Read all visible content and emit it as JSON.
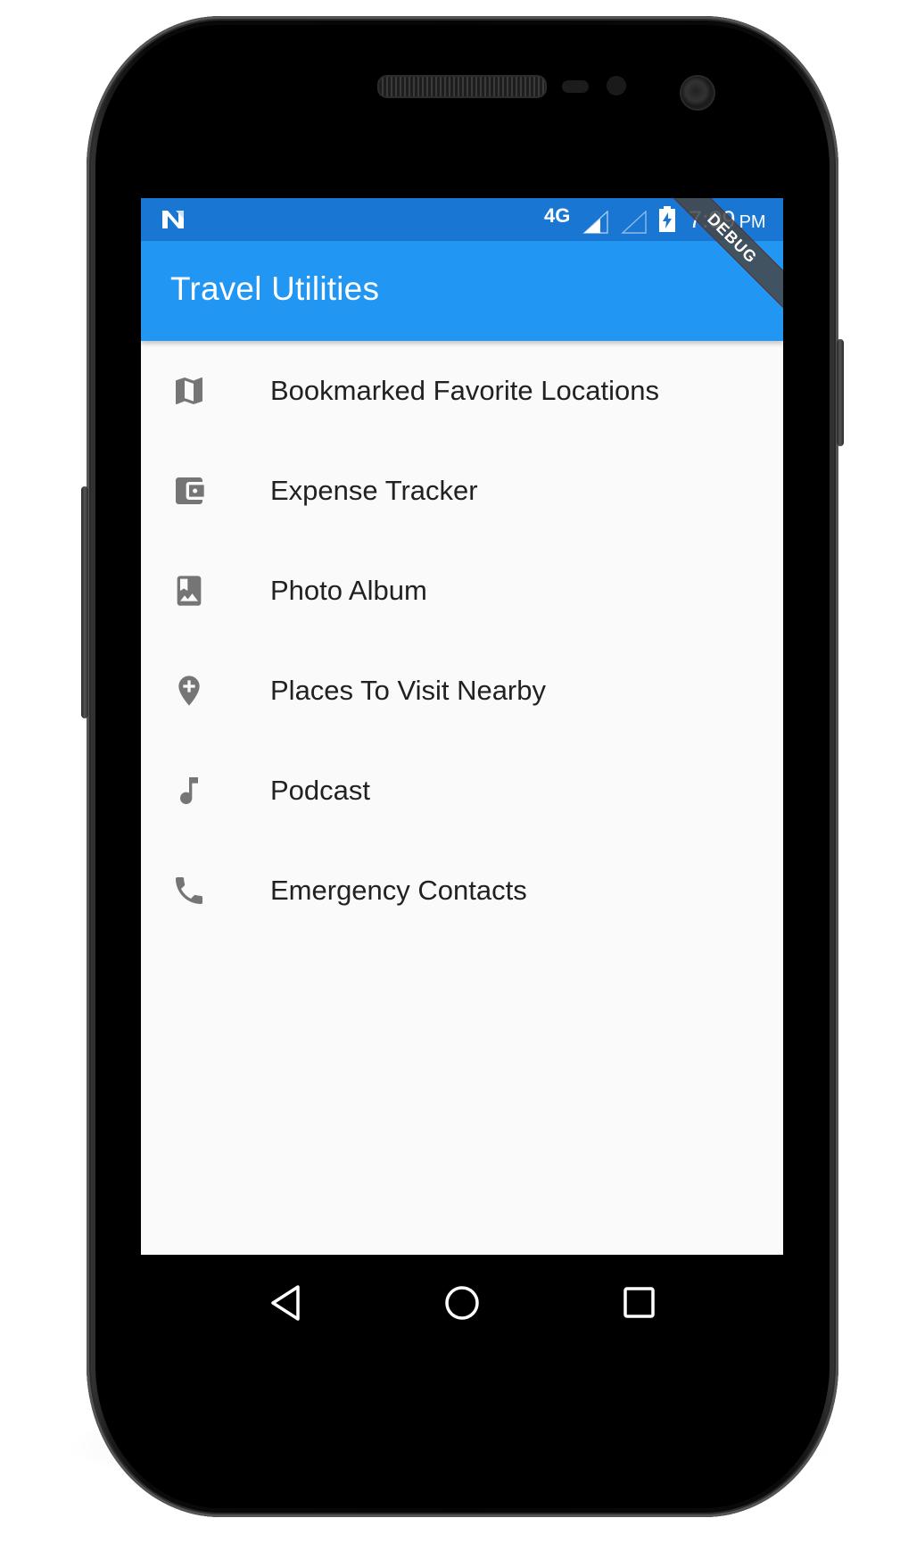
{
  "status_bar": {
    "network": "4G",
    "time": "7:09",
    "ampm": "PM",
    "background": "#1976d2"
  },
  "app_bar": {
    "title": "Travel Utilities",
    "background": "#2196f3"
  },
  "debug_banner": "DEBUG",
  "list": {
    "icon_color": "#757575",
    "items": [
      {
        "label": "Bookmarked Favorite Locations",
        "icon": "map-icon"
      },
      {
        "label": "Expense Tracker",
        "icon": "wallet-icon"
      },
      {
        "label": "Photo Album",
        "icon": "photo-album-icon"
      },
      {
        "label": "Places To Visit Nearby",
        "icon": "add-location-icon"
      },
      {
        "label": "Podcast",
        "icon": "music-note-icon"
      },
      {
        "label": "Emergency Contacts",
        "icon": "phone-icon"
      }
    ]
  },
  "nav_bar": {
    "back": "back-icon",
    "home": "home-icon",
    "recents": "recents-icon"
  }
}
